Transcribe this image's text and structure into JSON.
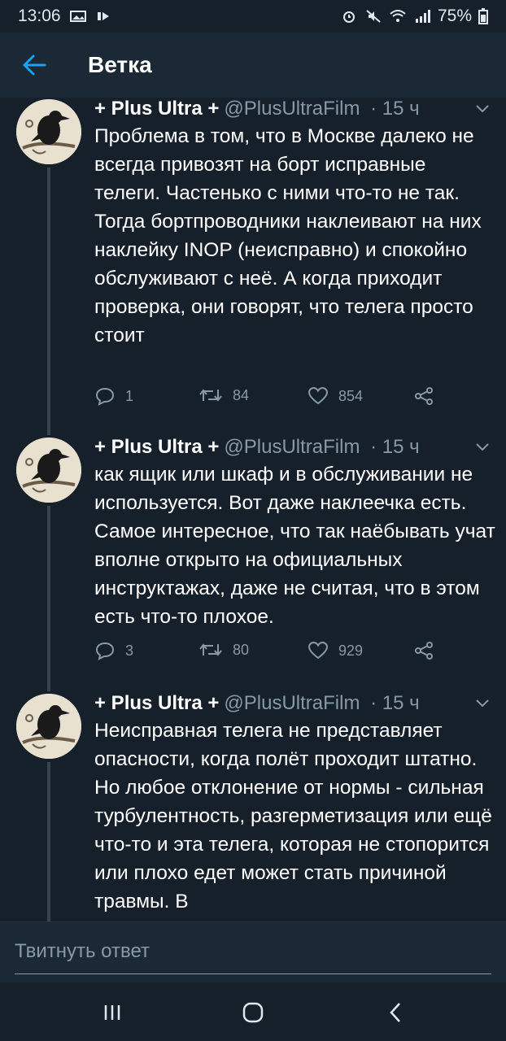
{
  "status": {
    "time": "13:06",
    "battery": "75%"
  },
  "appbar": {
    "title": "Ветка"
  },
  "tweets": [
    {
      "name": "+ Plus Ultra +",
      "handle": "@PlusUltraFilm",
      "time": "· 15 ч",
      "text": "Проблема в том, что в Москве далеко не всегда привозят на борт исправные телеги. Частенько с ними что-то не так. Тогда бортпроводники наклеивают на них наклейку INOP (неисправно) и спокойно обслуживают с неё. А когда приходит проверка, они говорят, что телега просто стоит",
      "replies": "1",
      "retweets": "84",
      "likes": "854"
    },
    {
      "name": "+ Plus Ultra +",
      "handle": "@PlusUltraFilm",
      "time": "· 15 ч",
      "text": "как ящик или шкаф и в обслуживании не используется. Вот даже наклеечка есть. Самое интересное, что так наёбывать учат вполне открыто на официальных инструктажах, даже не считая, что в этом есть что-то плохое.",
      "replies": "3",
      "retweets": "80",
      "likes": "929"
    },
    {
      "name": "+ Plus Ultra +",
      "handle": "@PlusUltraFilm",
      "time": "· 15 ч",
      "text": "Неисправная телега не представляет опасности, когда полёт проходит штатно. Но любое отклонение от нормы - сильная турбулентность, разгерметизация или ещё что-то и эта телега, которая не стопорится или плохо едет может стать причиной травмы. В",
      "replies": "",
      "retweets": "",
      "likes": ""
    }
  ],
  "reply": {
    "placeholder": "Твитнуть ответ"
  },
  "icons": {
    "back": "arrow-left-icon",
    "caret": "chevron-down-icon",
    "reply": "comment-icon",
    "retweet": "retweet-icon",
    "like": "heart-icon",
    "share": "share-icon"
  },
  "colors": {
    "background": "#15202b",
    "bar": "#1b2836",
    "accent": "#1da1f2",
    "muted": "#8899a6"
  }
}
